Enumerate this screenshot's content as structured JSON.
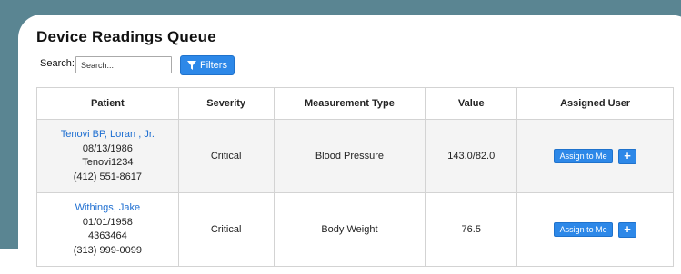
{
  "page": {
    "title": "Device Readings Queue"
  },
  "search": {
    "label": "Search:",
    "placeholder": "Search..."
  },
  "filters": {
    "label": "Filters",
    "icon": "filter-icon"
  },
  "table": {
    "headers": [
      "Patient",
      "Severity",
      "Measurement Type",
      "Value",
      "Assigned User"
    ],
    "rows": [
      {
        "patient_name": "Tenovi BP, Loran , Jr.",
        "dob": "08/13/1986",
        "id": "Tenovi1234",
        "phone": "(412) 551-8617",
        "severity": "Critical",
        "measurement_type": "Blood Pressure",
        "value": "143.0/82.0",
        "assign_label": "Assign to Me",
        "add_label": "+"
      },
      {
        "patient_name": "Withings, Jake",
        "dob": "01/01/1958",
        "id": "4363464",
        "phone": "(313) 999-0099",
        "severity": "Critical",
        "measurement_type": "Body Weight",
        "value": "76.5",
        "assign_label": "Assign to Me",
        "add_label": "+"
      }
    ]
  },
  "colors": {
    "backdrop": "#5a8592",
    "primary_button": "#2d88e8",
    "link": "#1f6fd1",
    "critical": "#c62828",
    "row_alt": "#f4f4f4"
  }
}
